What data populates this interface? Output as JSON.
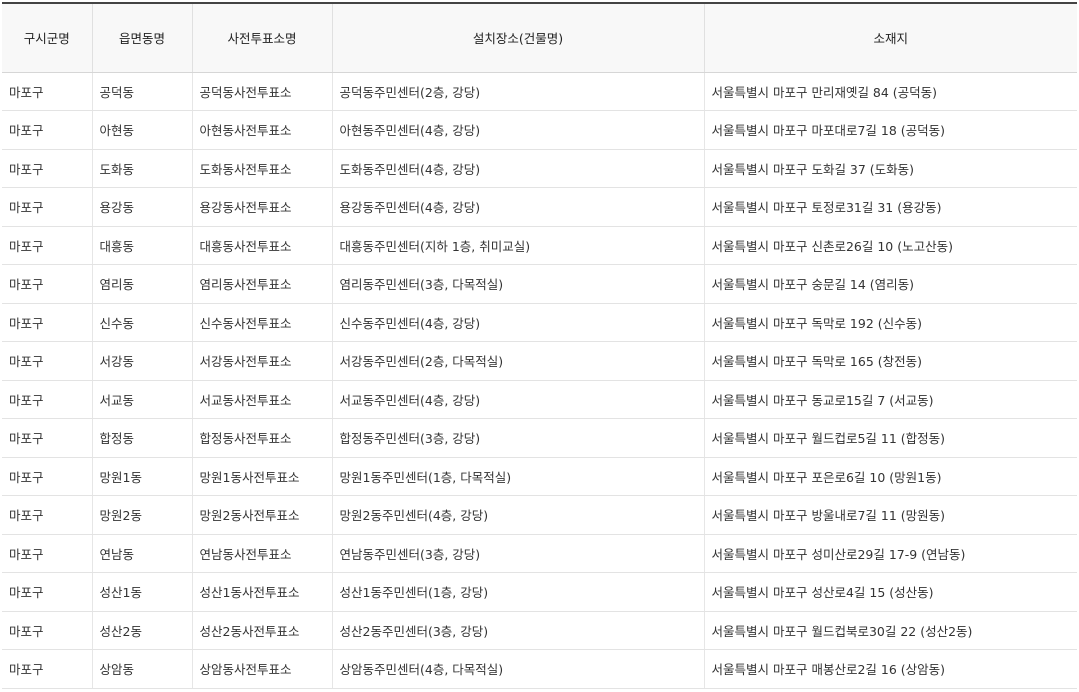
{
  "table": {
    "headers": [
      "구시군명",
      "읍면동명",
      "사전투표소명",
      "설치장소(건물명)",
      "소재지"
    ],
    "rows": [
      [
        "마포구",
        "공덕동",
        "공덕동사전투표소",
        "공덕동주민센터(2층, 강당)",
        "서울특별시 마포구 만리재옛길 84 (공덕동)"
      ],
      [
        "마포구",
        "아현동",
        "아현동사전투표소",
        "아현동주민센터(4층, 강당)",
        "서울특별시 마포구 마포대로7길 18 (공덕동)"
      ],
      [
        "마포구",
        "도화동",
        "도화동사전투표소",
        "도화동주민센터(4층, 강당)",
        "서울특별시 마포구 도화길 37 (도화동)"
      ],
      [
        "마포구",
        "용강동",
        "용강동사전투표소",
        "용강동주민센터(4층, 강당)",
        "서울특별시 마포구 토정로31길 31 (용강동)"
      ],
      [
        "마포구",
        "대흥동",
        "대흥동사전투표소",
        "대흥동주민센터(지하 1층, 취미교실)",
        "서울특별시 마포구 신촌로26길 10 (노고산동)"
      ],
      [
        "마포구",
        "염리동",
        "염리동사전투표소",
        "염리동주민센터(3층, 다목적실)",
        "서울특별시 마포구 숭문길 14 (염리동)"
      ],
      [
        "마포구",
        "신수동",
        "신수동사전투표소",
        "신수동주민센터(4층, 강당)",
        "서울특별시 마포구 독막로 192 (신수동)"
      ],
      [
        "마포구",
        "서강동",
        "서강동사전투표소",
        "서강동주민센터(2층, 다목적실)",
        "서울특별시 마포구 독막로 165 (창전동)"
      ],
      [
        "마포구",
        "서교동",
        "서교동사전투표소",
        "서교동주민센터(4층, 강당)",
        "서울특별시 마포구 동교로15길 7 (서교동)"
      ],
      [
        "마포구",
        "합정동",
        "합정동사전투표소",
        "합정동주민센터(3층, 강당)",
        "서울특별시 마포구 월드컵로5길 11 (합정동)"
      ],
      [
        "마포구",
        "망원1동",
        "망원1동사전투표소",
        "망원1동주민센터(1층, 다목적실)",
        "서울특별시 마포구 포은로6길 10 (망원1동)"
      ],
      [
        "마포구",
        "망원2동",
        "망원2동사전투표소",
        "망원2동주민센터(4층, 강당)",
        "서울특별시 마포구 방울내로7길 11 (망원동)"
      ],
      [
        "마포구",
        "연남동",
        "연남동사전투표소",
        "연남동주민센터(3층, 강당)",
        "서울특별시 마포구 성미산로29길 17-9 (연남동)"
      ],
      [
        "마포구",
        "성산1동",
        "성산1동사전투표소",
        "성산1동주민센터(1층, 강당)",
        "서울특별시 마포구 성산로4길 15 (성산동)"
      ],
      [
        "마포구",
        "성산2동",
        "성산2동사전투표소",
        "성산2동주민센터(3층, 강당)",
        "서울특별시 마포구 월드컵북로30길 22 (성산2동)"
      ],
      [
        "마포구",
        "상암동",
        "상암동사전투표소",
        "상암동주민센터(4층, 다목적실)",
        "서울특별시 마포구 매봉산로2길 16 (상암동)"
      ]
    ]
  }
}
